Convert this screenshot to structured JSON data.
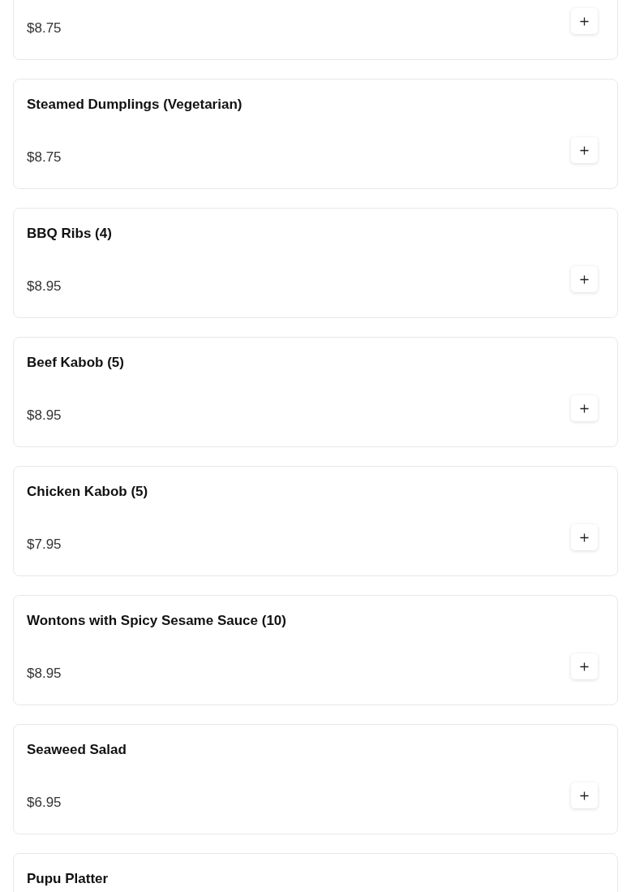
{
  "menu_items": [
    {
      "price": "$8.75"
    },
    {
      "name": "Steamed Dumplings (Vegetarian)",
      "price": "$8.75"
    },
    {
      "name": "BBQ Ribs (4)",
      "price": "$8.95"
    },
    {
      "name": "Beef Kabob (5)",
      "price": "$8.95"
    },
    {
      "name": "Chicken Kabob (5)",
      "price": "$7.95"
    },
    {
      "name": "Wontons with Spicy Sesame Sauce (10)",
      "price": "$8.95"
    },
    {
      "name": "Seaweed Salad",
      "price": "$6.95"
    },
    {
      "name": "Pupu Platter"
    }
  ]
}
